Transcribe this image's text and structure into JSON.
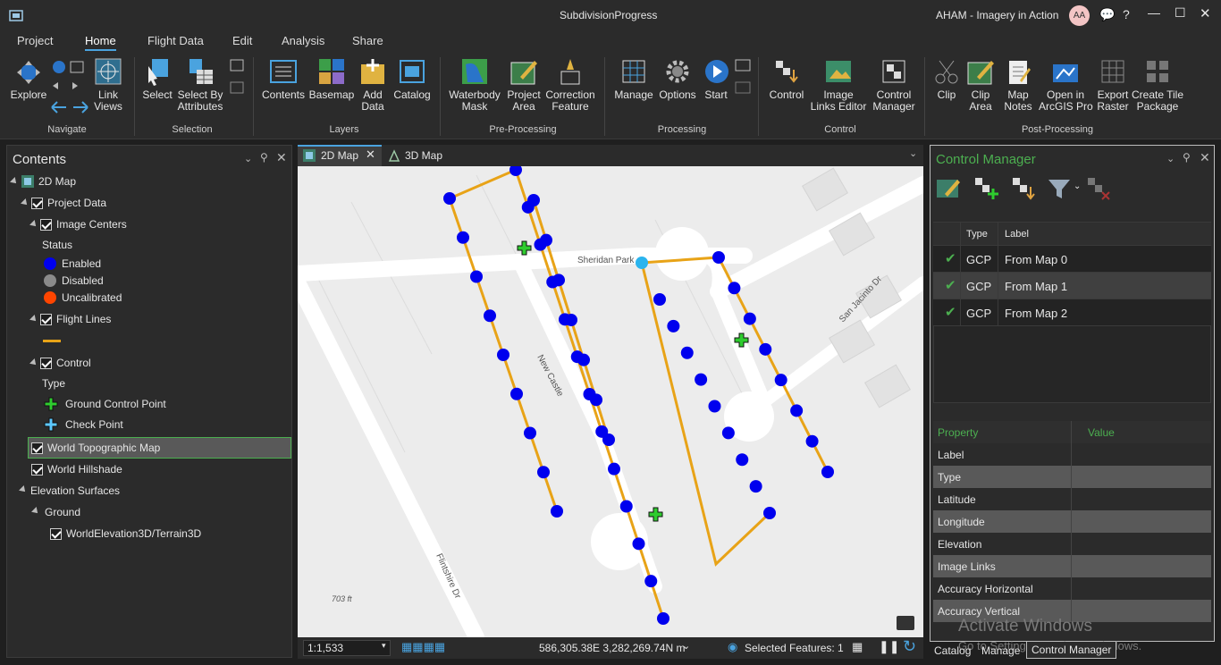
{
  "titlebar": {
    "project": "SubdivisionProgress",
    "user": "AHAM - Imagery in Action",
    "avatar": "AA"
  },
  "tabs": [
    "Project",
    "Home",
    "Flight Data",
    "Edit",
    "Analysis",
    "Share"
  ],
  "ribbon": {
    "navigate": {
      "explore": "Explore",
      "link_views": "Link\nViews",
      "group": "Navigate"
    },
    "selection": {
      "select": "Select",
      "select_by_attr": "Select By\nAttributes",
      "group": "Selection"
    },
    "layers": {
      "contents": "Contents",
      "basemap": "Basemap",
      "add_data": "Add\nData",
      "catalog": "Catalog",
      "group": "Layers"
    },
    "preprocessing": {
      "waterbody": "Waterbody\nMask",
      "project_area": "Project\nArea",
      "correction": "Correction\nFeature",
      "group": "Pre-Processing"
    },
    "processing": {
      "manage": "Manage",
      "options": "Options",
      "start": "Start",
      "group": "Processing"
    },
    "control": {
      "control": "Control",
      "image_links": "Image\nLinks Editor",
      "control_mgr": "Control\nManager",
      "group": "Control"
    },
    "postprocessing": {
      "clip": "Clip",
      "clip_area": "Clip\nArea",
      "map_notes": "Map\nNotes",
      "open_pro": "Open in\nArcGIS Pro",
      "export_raster": "Export\nRaster",
      "create_tile": "Create Tile\nPackage",
      "group": "Post-Processing"
    }
  },
  "contents": {
    "title": "Contents",
    "map": "2D Map",
    "project_data": "Project Data",
    "image_centers": "Image Centers",
    "status": "Status",
    "enabled": "Enabled",
    "disabled": "Disabled",
    "uncalibrated": "Uncalibrated",
    "flight_lines": "Flight Lines",
    "control": "Control",
    "type": "Type",
    "gcp": "Ground Control Point",
    "check_point": "Check Point",
    "world_topo": "World Topographic Map",
    "hillshade": "World Hillshade",
    "elevation": "Elevation Surfaces",
    "ground": "Ground",
    "terrain": "WorldElevation3D/Terrain3D"
  },
  "map": {
    "tab_2d": "2D Map",
    "tab_3d": "3D Map",
    "labels": {
      "sheridan": "Sheridan Park",
      "newcastle": "New Castle",
      "sanjacinto": "San Jacinto Dr",
      "flintshire": "Flintshire Dr",
      "elev": "703 ft"
    },
    "scale": "1:1,533",
    "coords": "586,305.38E 3,282,269.74N m",
    "selected": "Selected Features: 1"
  },
  "control_manager": {
    "title": "Control Manager",
    "col_type": "Type",
    "col_label": "Label",
    "rows": [
      {
        "type": "GCP",
        "label": "From Map 0"
      },
      {
        "type": "GCP",
        "label": "From Map 1"
      },
      {
        "type": "GCP",
        "label": "From Map 2"
      }
    ],
    "prop_header": "Property",
    "value_header": "Value",
    "properties": [
      "Label",
      "Type",
      "Latitude",
      "Longitude",
      "Elevation",
      "Image Links",
      "Accuracy Horizontal",
      "Accuracy Vertical"
    ]
  },
  "bottom_tabs": [
    "Catalog",
    "Manage",
    "Control Manager"
  ],
  "watermark": {
    "line1": "Activate Windows",
    "line2": "Go to Settings to activate Windows."
  },
  "colors": {
    "accent": "#4aa3df",
    "enabled": "#0000ee",
    "disabled": "#8a8a8a",
    "uncalibrated": "#ff4500",
    "flight_line": "#e8a317",
    "gcp": "#2ecc2e",
    "checkpoint": "#5cc8ff"
  }
}
